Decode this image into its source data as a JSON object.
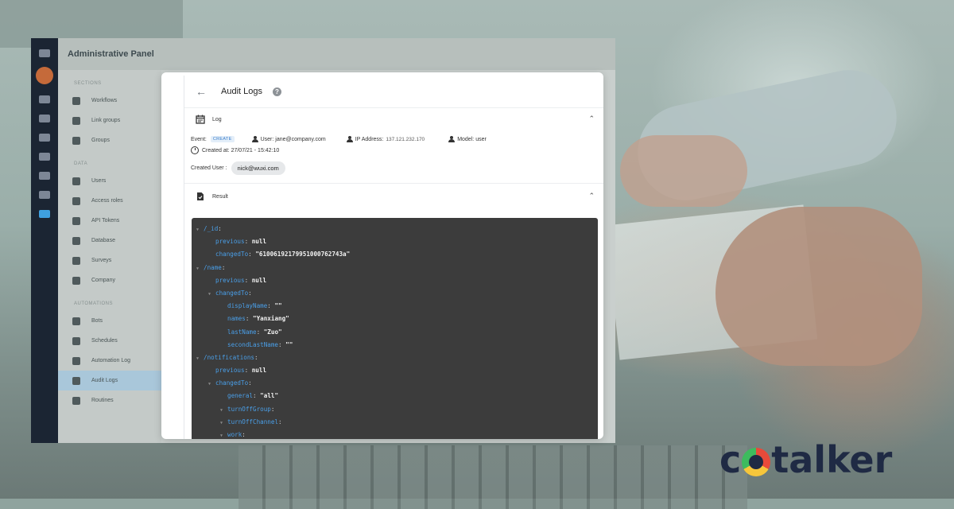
{
  "admin": {
    "title": "Administrative Panel",
    "sections": [
      "SECTIONS",
      "DATA",
      "AUTOMATIONS"
    ],
    "items_a": [
      "Workflows",
      "Link groups",
      "Groups"
    ],
    "items_b": [
      "Users",
      "Access roles",
      "API Tokens",
      "Database",
      "Surveys",
      "Company"
    ],
    "items_c": [
      "Bots",
      "Schedules",
      "Automation Log",
      "Audit Logs",
      "Routines"
    ]
  },
  "audit": {
    "title": "Audit Logs",
    "log_section": "Log",
    "event_label": "Event:",
    "event_value": "CREATE",
    "user_label": "User:",
    "user_value": "jane@company.com",
    "ip_label": "IP Address:",
    "ip_value": "137.121.232.170",
    "model_label": "Model:",
    "model_value": "user",
    "created_at": "Created at: 27/07/21 - 15:42:10",
    "created_user_label": "Created User :",
    "created_user_value": "nick@wuxi.com",
    "result_section": "Result"
  },
  "code_lines": [
    {
      "indent": 0,
      "tri": true,
      "key": "/_id",
      "sep": ":",
      "val": ""
    },
    {
      "indent": 1,
      "tri": false,
      "key": "previous",
      "sep": ": ",
      "val": "null"
    },
    {
      "indent": 1,
      "tri": false,
      "key": "changedTo",
      "sep": ": ",
      "val": "\"610061921799510007627 43a\""
    },
    {
      "indent": 0,
      "tri": true,
      "key": "/name",
      "sep": ":",
      "val": ""
    },
    {
      "indent": 1,
      "tri": false,
      "key": "previous",
      "sep": ": ",
      "val": "null"
    },
    {
      "indent": 1,
      "tri": true,
      "key": "changedTo",
      "sep": ":",
      "val": ""
    },
    {
      "indent": 2,
      "tri": false,
      "key": "displayName",
      "sep": ": ",
      "val": "\"\""
    },
    {
      "indent": 2,
      "tri": false,
      "key": "names",
      "sep": ": ",
      "val": "\"Yanxiang\""
    },
    {
      "indent": 2,
      "tri": false,
      "key": "lastName",
      "sep": ": ",
      "val": "\"Zuo\""
    },
    {
      "indent": 2,
      "tri": false,
      "key": "secondLastName",
      "sep": ": ",
      "val": "\"\""
    },
    {
      "indent": 0,
      "tri": true,
      "key": "/notifications",
      "sep": ":",
      "val": ""
    },
    {
      "indent": 1,
      "tri": false,
      "key": "previous",
      "sep": ": ",
      "val": "null"
    },
    {
      "indent": 1,
      "tri": true,
      "key": "changedTo",
      "sep": ":",
      "val": ""
    },
    {
      "indent": 2,
      "tri": false,
      "key": "general",
      "sep": ": ",
      "val": "\"all\""
    },
    {
      "indent": 2,
      "tri": true,
      "key": "turnOffGroup",
      "sep": ":",
      "val": ""
    },
    {
      "indent": 2,
      "tri": true,
      "key": "turnOffChannel",
      "sep": ":",
      "val": ""
    },
    {
      "indent": 2,
      "tri": true,
      "key": "work",
      "sep": ":",
      "val": ""
    }
  ],
  "logo": {
    "left": "c",
    "right": "talker"
  },
  "colors": {
    "code_bg": "#3c3c3c",
    "code_key": "#4a9fe8",
    "brand_navy": "#1f2a44",
    "badge": "#3b7ecb"
  }
}
